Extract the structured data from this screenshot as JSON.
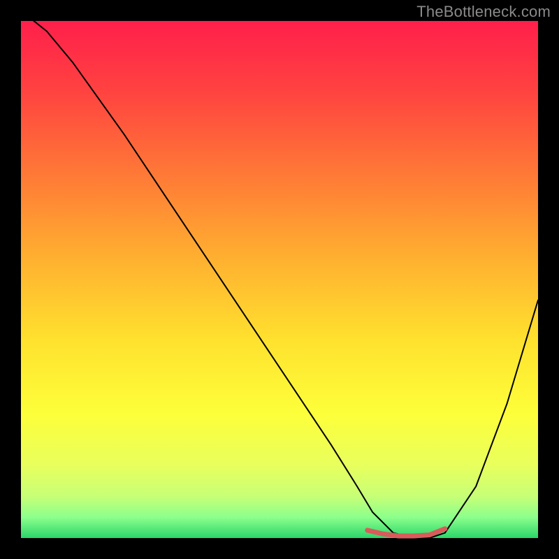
{
  "watermark": "TheBottleneck.com",
  "chart_data": {
    "type": "line",
    "title": "",
    "xlabel": "",
    "ylabel": "",
    "xlim": [
      0,
      100
    ],
    "ylim": [
      0,
      100
    ],
    "background_gradient_stops": [
      {
        "pct": 0,
        "color": "#ff1f4b"
      },
      {
        "pct": 14,
        "color": "#ff4440"
      },
      {
        "pct": 30,
        "color": "#ff7a36"
      },
      {
        "pct": 46,
        "color": "#ffb030"
      },
      {
        "pct": 62,
        "color": "#ffe22e"
      },
      {
        "pct": 76,
        "color": "#fdff3a"
      },
      {
        "pct": 86,
        "color": "#e8ff5d"
      },
      {
        "pct": 92,
        "color": "#c6ff77"
      },
      {
        "pct": 96,
        "color": "#8cff8c"
      },
      {
        "pct": 100,
        "color": "#2bd66a"
      }
    ],
    "series": [
      {
        "name": "bottleneck-curve",
        "color": "#000000",
        "width": 2,
        "x": [
          0,
          5,
          10,
          20,
          30,
          40,
          50,
          60,
          65,
          68,
          72,
          76,
          79,
          82,
          88,
          94,
          100
        ],
        "values": [
          102,
          98,
          92,
          78,
          63,
          48,
          33,
          18,
          10,
          5,
          1,
          0,
          0,
          1,
          10,
          26,
          46
        ]
      },
      {
        "name": "optimum-band",
        "color": "#d95b5b",
        "width": 7,
        "x": [
          67,
          70,
          73,
          76,
          79,
          82
        ],
        "values": [
          1.5,
          0.8,
          0.4,
          0.4,
          0.6,
          1.8
        ]
      }
    ],
    "optimum_range_x": [
      67,
      82
    ]
  }
}
